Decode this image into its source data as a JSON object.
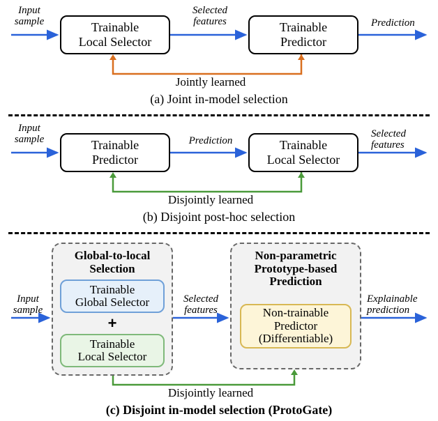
{
  "section_a": {
    "input_label": "Input\nsample",
    "box1_line1": "Trainable",
    "box1_line2": "Local Selector",
    "mid_label": "Selected\nfeatures",
    "box2_line1": "Trainable",
    "box2_line2": "Predictor",
    "out_label": "Prediction",
    "feedback_label": "Jointly learned",
    "caption": "(a) Joint in-model selection"
  },
  "section_b": {
    "input_label": "Input\nsample",
    "box1_line1": "Trainable",
    "box1_line2": "Predictor",
    "mid_label": "Prediction",
    "box2_line1": "Trainable",
    "box2_line2": "Local Selector",
    "out_label": "Selected\nfeatures",
    "feedback_label": "Disjointly learned",
    "caption": "(b) Disjoint post-hoc selection"
  },
  "section_c": {
    "input_label": "Input\nsample",
    "group1_title_line1": "Global-to-local",
    "group1_title_line2": "Selection",
    "g1_box1_line1": "Trainable",
    "g1_box1_line2": "Global Selector",
    "plus": "+",
    "g1_box2_line1": "Trainable",
    "g1_box2_line2": "Local Selector",
    "mid_label": "Selected\nfeatures",
    "group2_title_line1": "Non-parametric",
    "group2_title_line2": "Prototype-based",
    "group2_title_line3": "Prediction",
    "g2_box_line1": "Non-trainable",
    "g2_box_line2": "Predictor",
    "g2_box_line3": "(Differentiable)",
    "out_label": "Explainable\nprediction",
    "feedback_label": "Disjointly learned",
    "caption": "(c) Disjoint in-model selection (ProtoGate)"
  },
  "colors": {
    "blue_arrow": "#2a62d9",
    "orange_arrow": "#d96f1f",
    "green_arrow": "#4a9a3a",
    "blue_box_border": "#6fa0d8",
    "blue_box_fill": "#e6f0fa",
    "green_box_border": "#7fb97a",
    "green_box_fill": "#e9f5e6",
    "yellow_box_border": "#d8b854",
    "yellow_box_fill": "#fdf5d8"
  }
}
